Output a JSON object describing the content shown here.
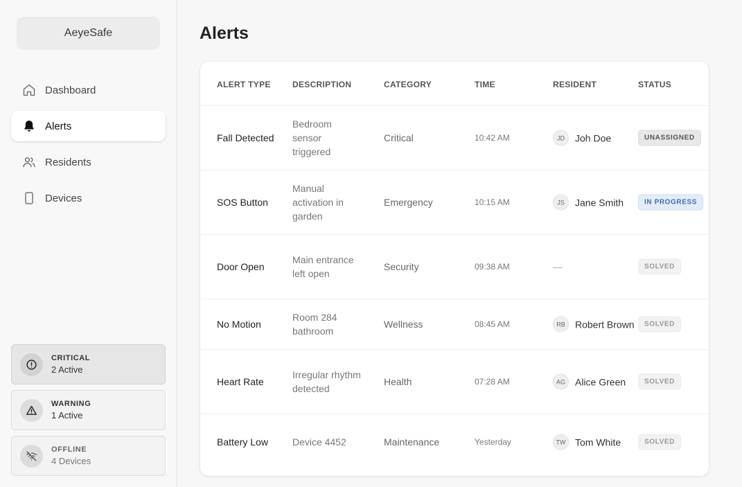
{
  "app": {
    "name": "AeyeSafe"
  },
  "sidebar": {
    "items": [
      {
        "label": "Dashboard",
        "icon": "home-icon"
      },
      {
        "label": "Alerts",
        "icon": "bell-icon",
        "active": true
      },
      {
        "label": "Residents",
        "icon": "users-icon"
      },
      {
        "label": "Devices",
        "icon": "device-icon"
      }
    ],
    "stats": [
      {
        "label": "CRITICAL",
        "value": "2 Active",
        "icon": "alert-circle-icon"
      },
      {
        "label": "WARNING",
        "value": "1 Active",
        "icon": "warning-triangle-icon"
      },
      {
        "label": "OFFLINE",
        "value": "4 Devices",
        "icon": "wifi-off-icon"
      }
    ]
  },
  "main": {
    "title": "Alerts",
    "table": {
      "headers": [
        "ALERT TYPE",
        "DESCRIPTION",
        "CATEGORY",
        "TIME",
        "RESIDENT",
        "STATUS"
      ],
      "rows": [
        {
          "type": "Fall Detected",
          "description": "Bedroom sensor triggered",
          "category": "Critical",
          "time": "10:42 AM",
          "initials": "JD",
          "resident": "Joh Doe",
          "status": "UNASSIGNED"
        },
        {
          "type": "SOS Button",
          "description": "Manual activation in garden",
          "category": "Emergency",
          "time": "10:15 AM",
          "initials": "JS",
          "resident": "Jane Smith",
          "status": "IN PROGRESS"
        },
        {
          "type": "Door Open",
          "description": "Main entrance left open",
          "category": "Security",
          "time": "09:38 AM",
          "initials": "",
          "resident": "—",
          "status": "SOLVED"
        },
        {
          "type": "No Motion",
          "description": "Room 284 bathroom",
          "category": "Wellness",
          "time": "08:45 AM",
          "initials": "RB",
          "resident": "Robert Brown",
          "status": "SOLVED"
        },
        {
          "type": "Heart Rate",
          "description": "Irregular rhythm detected",
          "category": "Health",
          "time": "07:28 AM",
          "initials": "AG",
          "resident": "Alice Green",
          "status": "SOLVED"
        },
        {
          "type": "Battery Low",
          "description": "Device 4452",
          "category": "Maintenance",
          "time": "Yesterday",
          "initials": "TW",
          "resident": "Tom White",
          "status": "SOLVED"
        }
      ]
    }
  }
}
